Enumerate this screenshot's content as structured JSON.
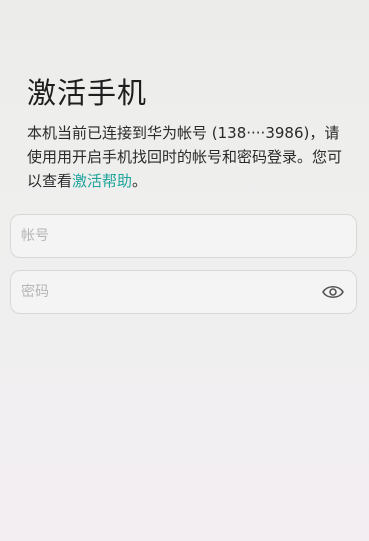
{
  "page": {
    "title": "激活手机",
    "description_prefix": "本机当前已连接到华为帐号 (138····3986)，请使用用开启手机找回时的帐号和密码登录。您可以查看",
    "help_link": "激活帮助",
    "description_suffix": "。"
  },
  "form": {
    "account_placeholder": "帐号",
    "password_placeholder": "密码"
  },
  "icons": {
    "password_visibility": "eye-icon"
  },
  "colors": {
    "link": "#1fa39c"
  }
}
